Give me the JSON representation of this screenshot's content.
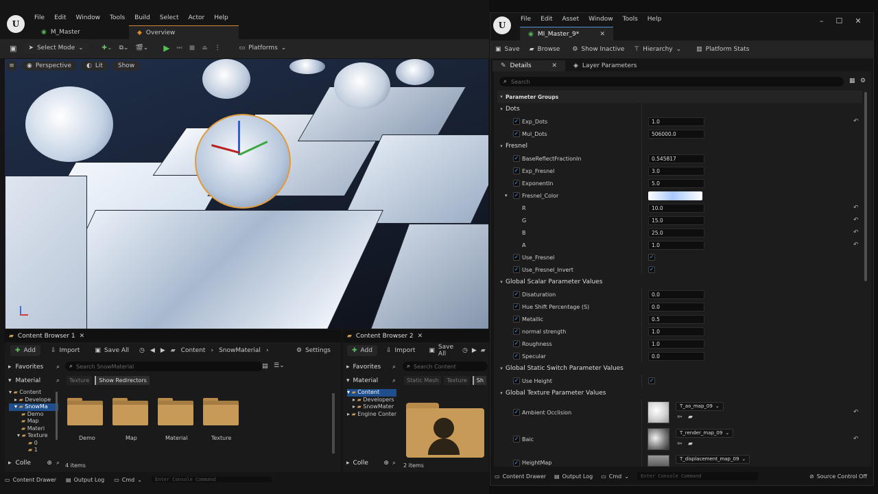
{
  "left": {
    "menu": [
      "File",
      "Edit",
      "Window",
      "Tools",
      "Build",
      "Select",
      "Actor",
      "Help"
    ],
    "tabs": [
      "M_Master",
      "Overview"
    ],
    "toolbar": {
      "mode": "Select Mode",
      "platforms": "Platforms"
    },
    "viewport": {
      "perspective": "Perspective",
      "lit": "Lit",
      "show": "Show"
    }
  },
  "cb1": {
    "title": "Content Browser 1",
    "add": "Add",
    "import": "Import",
    "save_all": "Save All",
    "path": [
      "Content",
      "SnowMaterial"
    ],
    "settings": "Settings",
    "favorites": "Favorites",
    "material": "Material",
    "tree": [
      "Content",
      "Develope",
      "SnowMa",
      "Demo",
      "Map",
      "Materi",
      "Texture",
      "0",
      "1"
    ],
    "search_placeholder": "Search SnowMaterial",
    "filters": [
      "Texture",
      "Show Redirectors"
    ],
    "folders": [
      "Demo",
      "Map",
      "Material",
      "Texture"
    ],
    "count": "4 items",
    "collections": "Colle"
  },
  "cb2": {
    "title": "Content Browser 2",
    "add": "Add",
    "import": "Import",
    "save_all": "Save All",
    "favorites": "Favorites",
    "material": "Material",
    "tree": [
      "Content",
      "Developers",
      "SnowMater",
      "Engine Conten"
    ],
    "search_placeholder": "Search Content",
    "filters": [
      "Static Mesh",
      "Texture",
      "Sh"
    ],
    "count": "2 items",
    "collections": "Colle"
  },
  "bottom_left": {
    "drawer": "Content Drawer",
    "output": "Output Log",
    "cmd": "Cmd",
    "console_placeholder": "Enter Console Command"
  },
  "right": {
    "menu": [
      "File",
      "Edit",
      "Asset",
      "Window",
      "Tools",
      "Help"
    ],
    "tab": "MI_Master_9*",
    "toolbar": [
      "Save",
      "Browse",
      "Show Inactive",
      "Hierarchy",
      "Platform Stats"
    ],
    "panel_tabs": [
      "Details",
      "Layer Parameters"
    ],
    "search_placeholder": "Search",
    "groups": {
      "parameter_groups": "Parameter Groups",
      "dots": "Dots",
      "fresnel": "Fresnel",
      "scalar": "Global Scalar Parameter Values",
      "static_switch": "Global Static Switch Parameter Values",
      "texture": "Global Texture Parameter Values"
    },
    "dots": [
      {
        "name": "Exp_Dots",
        "value": "1.0"
      },
      {
        "name": "Mul_Dots",
        "value": "506000.0"
      }
    ],
    "fresnel": [
      {
        "name": "BaseReflectFractionIn",
        "value": "0.545817"
      },
      {
        "name": "Exp_Fresnel",
        "value": "3.0"
      },
      {
        "name": "ExponentIn",
        "value": "5.0"
      }
    ],
    "fresnel_color": {
      "name": "Fresnel_Color",
      "R": "10.0",
      "G": "15.0",
      "B": "25.0",
      "A": "1.0",
      "labels": [
        "R",
        "G",
        "B",
        "A"
      ]
    },
    "fresnel_switches": [
      "Use_Fresnel",
      "Use_Fresnel_Invert"
    ],
    "scalars": [
      {
        "name": "Disaturation",
        "value": "0.0"
      },
      {
        "name": "Hue Shift Percentage (S)",
        "value": "0.0"
      },
      {
        "name": "Metallic",
        "value": "0.5"
      },
      {
        "name": "normal strength",
        "value": "1.0"
      },
      {
        "name": "Roughness",
        "value": "1.0"
      },
      {
        "name": "Specular",
        "value": "0.0"
      }
    ],
    "switch": "Use Height",
    "textures": [
      {
        "name": "Ambient Occlision",
        "value": "T_ao_map_09"
      },
      {
        "name": "Baic",
        "value": "T_render_map_09"
      },
      {
        "name": "HeightMap",
        "value": "T_displacement_map_09"
      }
    ],
    "bottom": {
      "drawer": "Content Drawer",
      "output": "Output Log",
      "cmd": "Cmd",
      "console_placeholder": "Enter Console Command",
      "source": "Source Control Off"
    }
  }
}
